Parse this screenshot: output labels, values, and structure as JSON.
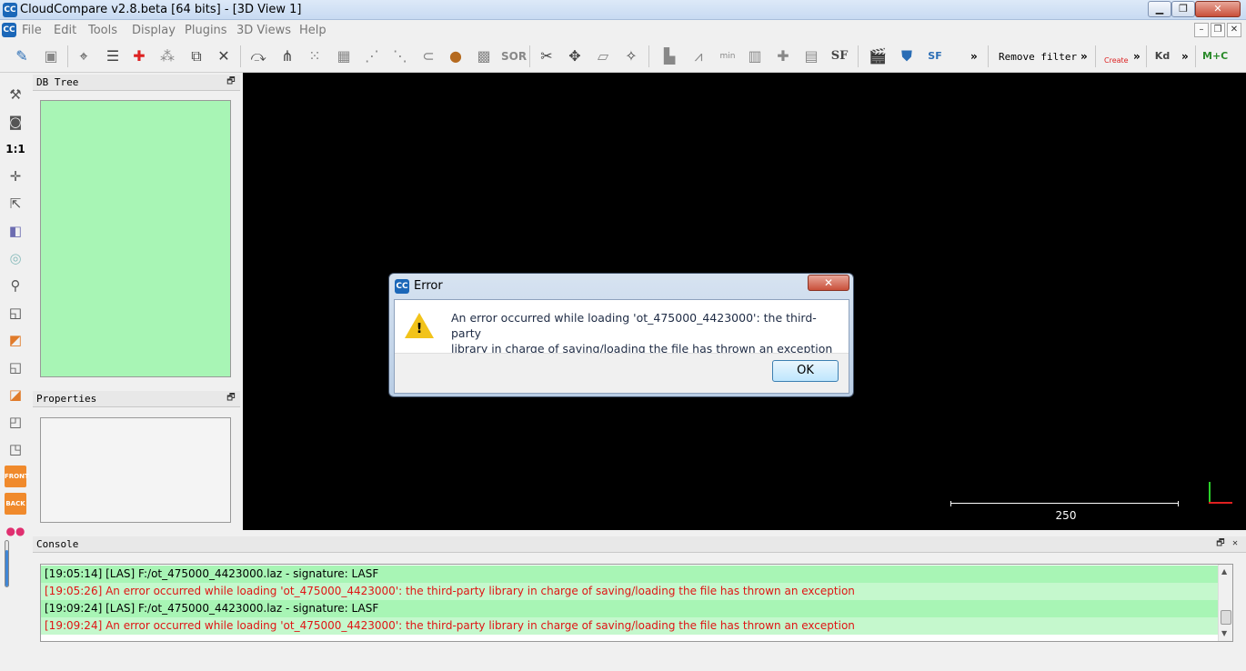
{
  "window": {
    "title": "CloudCompare v2.8.beta [64 bits] - [3D View 1]",
    "app_icon": "CC",
    "minimize": "▁",
    "maximize": "❐",
    "close": "✕"
  },
  "menu": {
    "items": [
      "File",
      "Edit",
      "Tools",
      "Display",
      "Plugins",
      "3D Views",
      "Help"
    ],
    "mdi_minimize": "–",
    "mdi_restore": "❐",
    "mdi_close": "✕"
  },
  "toolbar": {
    "sor_label": "SOR",
    "sf_label": "SF",
    "remove_filter": "Remove filter",
    "more": "»",
    "canupo_label": "Create",
    "kd_label": "Kd",
    "mplusc_label": "M+C"
  },
  "left_toolbar": {
    "one_to_one": "1:1",
    "front": "FRONT",
    "back": "BACK"
  },
  "panels": {
    "db_tree": "DB Tree",
    "properties": "Properties",
    "console": "Console",
    "float_glyph": "🗗",
    "close_glyph": "✕"
  },
  "view3d": {
    "scale_value": "250"
  },
  "dialog": {
    "title": "Error",
    "close": "✕",
    "message_line1": "An error occurred while loading 'ot_475000_4423000': the third-party",
    "message_line2": "library in charge of saving/loading the file has thrown an exception",
    "ok": "OK",
    "warn_mark": "!"
  },
  "console": {
    "lines": [
      {
        "text": "[19:05:14] [LAS] F:/ot_475000_4423000.laz - signature: LASF",
        "error": false
      },
      {
        "text": "[19:05:26] An error occurred while loading 'ot_475000_4423000': the third-party library in charge of saving/loading the file has thrown an exception",
        "error": true
      },
      {
        "text": "[19:09:24] [LAS] F:/ot_475000_4423000.laz - signature: LASF",
        "error": false
      },
      {
        "text": "[19:09:24] An error occurred while loading 'ot_475000_4423000': the third-party library in charge of saving/loading the file has thrown an exception",
        "error": true
      }
    ]
  },
  "colors": {
    "tree_bg": "#a8f5b5",
    "error_text": "#e01515",
    "view_bg": "#000000"
  }
}
